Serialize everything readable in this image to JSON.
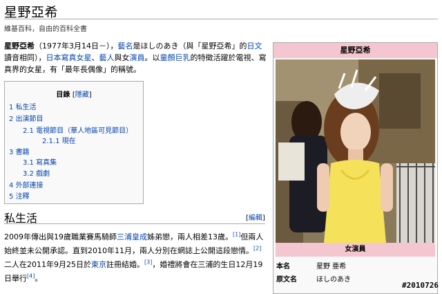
{
  "page": {
    "title": "星野亞希",
    "tagline": "維基百科，自由的百科全書"
  },
  "lead": {
    "name": "星野亞希",
    "t1": "（1977年3月14日－），",
    "l1": "藝名",
    "t2": "是ほしのあき（與「星野亞希」的",
    "l2": "日文",
    "t3": "讀音相同），",
    "l3": "日本",
    "l4": "寫真女星",
    "t4": "、",
    "l5": "藝人",
    "t5": "與女",
    "l6": "演員",
    "t6": "。以",
    "l7": "童顏巨乳",
    "t7": "的特徵活躍於電視、寫真界的女星，有「最年長偶像」的稱號。"
  },
  "toc": {
    "heading": "目錄",
    "hide_open": "[",
    "hide_label": "隱藏",
    "hide_close": "]",
    "items": [
      {
        "num": "1",
        "label": "私生活"
      },
      {
        "num": "2",
        "label": "出演節目"
      },
      {
        "num": "2.1",
        "label": "電視節目（華人地區可見節目）"
      },
      {
        "num": "2.1.1",
        "label": "現在"
      },
      {
        "num": "3",
        "label": "書籍"
      },
      {
        "num": "3.1",
        "label": "寫真集"
      },
      {
        "num": "3.2",
        "label": "戲劇"
      },
      {
        "num": "4",
        "label": "外部連接"
      },
      {
        "num": "5",
        "label": "注釋"
      }
    ]
  },
  "section": {
    "title": "私生活",
    "edit_open": "[",
    "edit_label": "編輯",
    "edit_close": "]",
    "p1": "2009年傳出與19歲職業賽馬騎師",
    "l1": "三浦皇成",
    "p2": "姊弟戀，兩人相差13歲。",
    "ref1": "[1]",
    "p3": "但兩人始終並未公開承認。直到2010年11月，兩人分別在網誌上公開這段戀情。",
    "ref2": "[2]",
    "p4": "二人在2011年9月25日於",
    "l2": "東京",
    "p5": "註冊結婚。",
    "ref3": "[3]",
    "p6": "，婚禮將會在三浦的生日12月19日舉行",
    "ref4": "[4]",
    "p7": "。"
  },
  "infobox": {
    "header": "星野亞希",
    "subheader": "女演員",
    "rows": [
      {
        "key": "本名",
        "value": "星野 亜希"
      },
      {
        "key": "原文名",
        "value": "ほしのあき"
      }
    ]
  },
  "watermark": "#2010726",
  "colors": {
    "link": "#0645ad",
    "infobox_header": "#f4c7d0",
    "dress": "#f5e15a"
  }
}
